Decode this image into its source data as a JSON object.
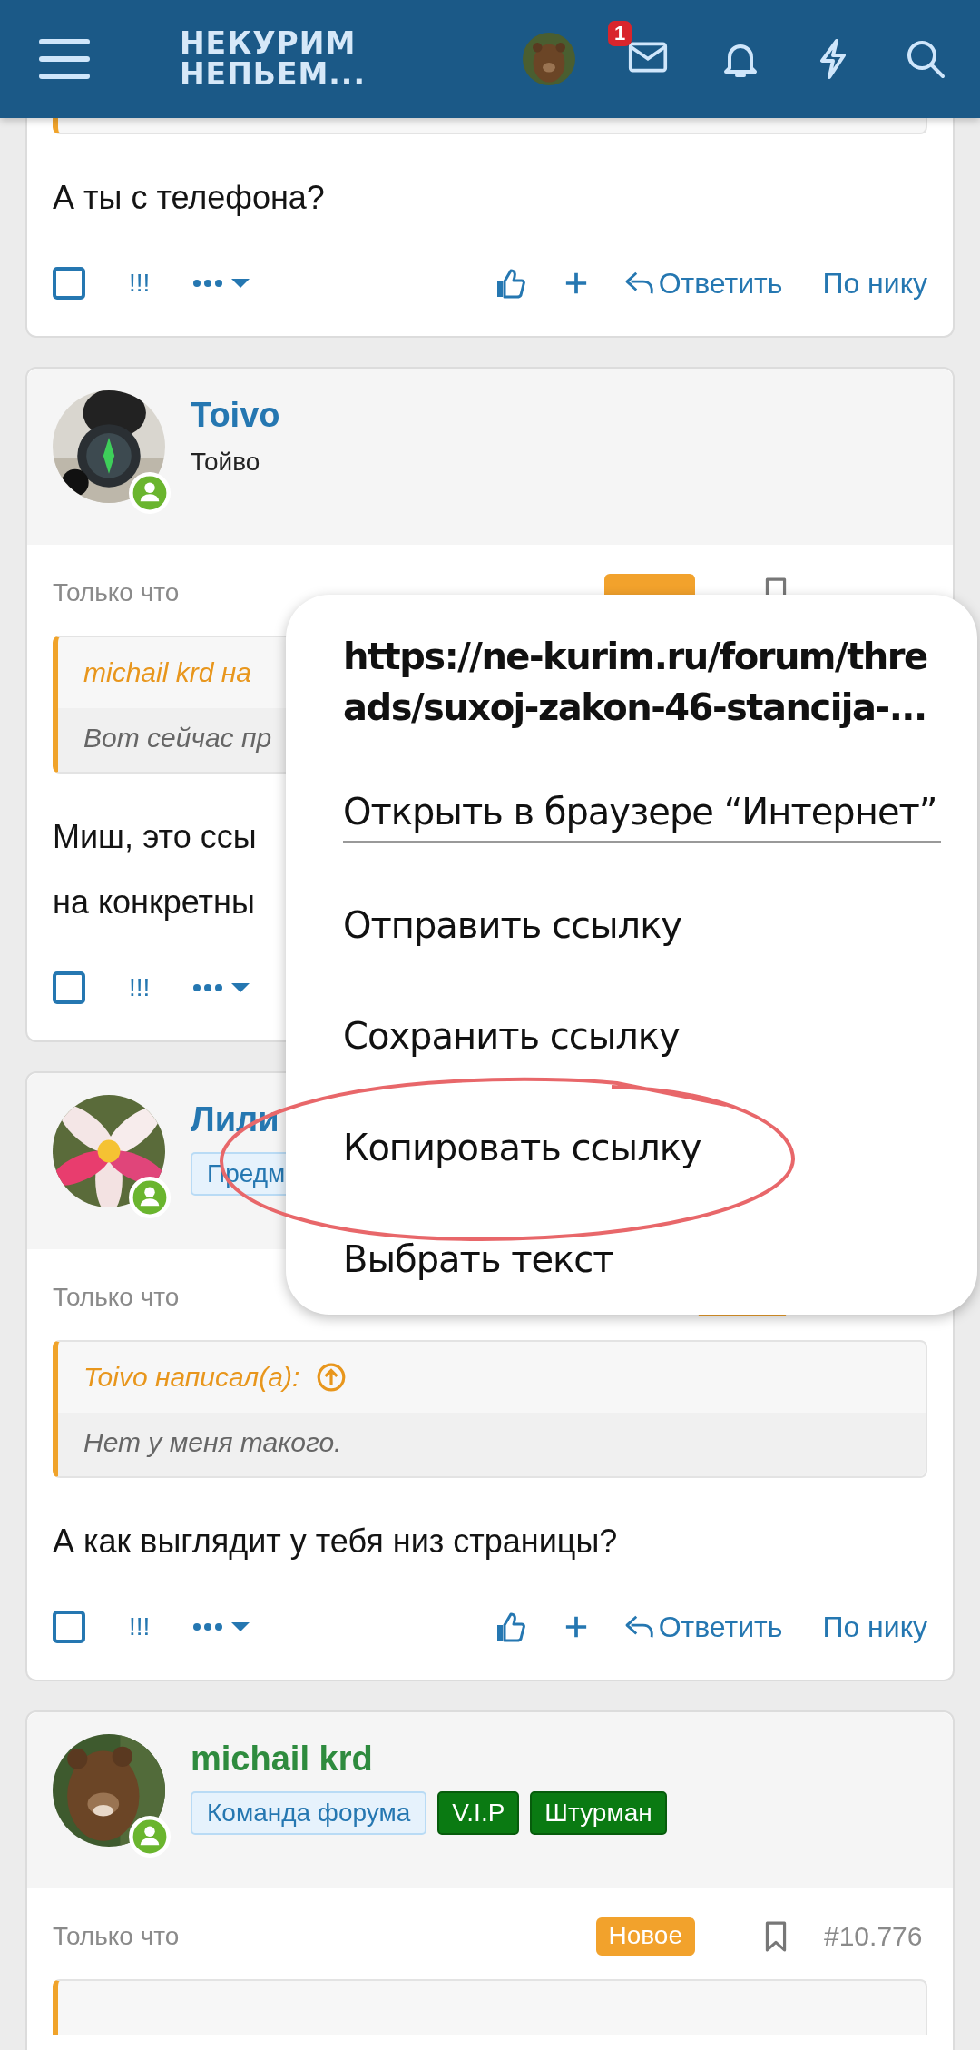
{
  "header": {
    "logo": "НЕКУРИМ НЕПЬЕМ...",
    "inbox_count": "1"
  },
  "posts": [
    {
      "quote": {
        "partial": true
      },
      "text": [
        "А ты с телефона?"
      ],
      "actions": {
        "checked": false,
        "flag": "!!!",
        "reply": "Ответить",
        "by_nick": "По нику"
      }
    },
    {
      "user": {
        "name": "Toivo",
        "color": "#2577b1",
        "title": "Тойво",
        "online": true
      },
      "meta": {
        "time": "Только что",
        "is_new": true,
        "bookmark": true
      },
      "quote": {
        "author": "michail krd на",
        "text": "Вот сейчас пр"
      },
      "text": [
        "Миш, это ссы",
        "на конкретны"
      ],
      "actions": {
        "checked": false,
        "flag": "!!!"
      }
    },
    {
      "user": {
        "name": "Лили",
        "color": "#2577b1",
        "online": true,
        "badges": [
          {
            "label": "Предм",
            "kind": "team"
          }
        ]
      },
      "meta": {
        "time": "Только что",
        "is_new": true
      },
      "quote": {
        "author": "Toivo написал(а):",
        "text": "Нет у меня такого."
      },
      "text": [
        "А как выглядит у тебя низ страницы?"
      ],
      "actions": {
        "checked": false,
        "flag": "!!!",
        "reply": "Ответить",
        "by_nick": "По нику"
      }
    },
    {
      "user": {
        "name": "michail krd",
        "color": "#2e8b3e",
        "online": true,
        "badges": [
          {
            "label": "Команда форума",
            "kind": "team"
          },
          {
            "label": "V.I.P",
            "kind": "rank"
          },
          {
            "label": "Штурман",
            "kind": "rank"
          }
        ]
      },
      "meta": {
        "time": "Только что",
        "is_new": true,
        "new_label": "Новое",
        "bookmark": true,
        "number": "#10.776"
      },
      "quote": {
        "partial_top": true
      }
    }
  ],
  "context_menu": {
    "url": "https://ne-kurim.ru/forum/threads/suxoj-zakon-46-stancija-...",
    "items": [
      {
        "label": "Открыть в браузере “Интернет”",
        "divider_after": true,
        "circled": false
      },
      {
        "label": "Отправить ссылку",
        "divider_after": false,
        "circled": false
      },
      {
        "label": "Сохранить ссылку",
        "divider_after": false,
        "circled": false
      },
      {
        "label": "Копировать ссылку",
        "divider_after": false,
        "circled": true
      },
      {
        "label": "Выбрать текст",
        "divider_after": false,
        "circled": false
      }
    ]
  }
}
